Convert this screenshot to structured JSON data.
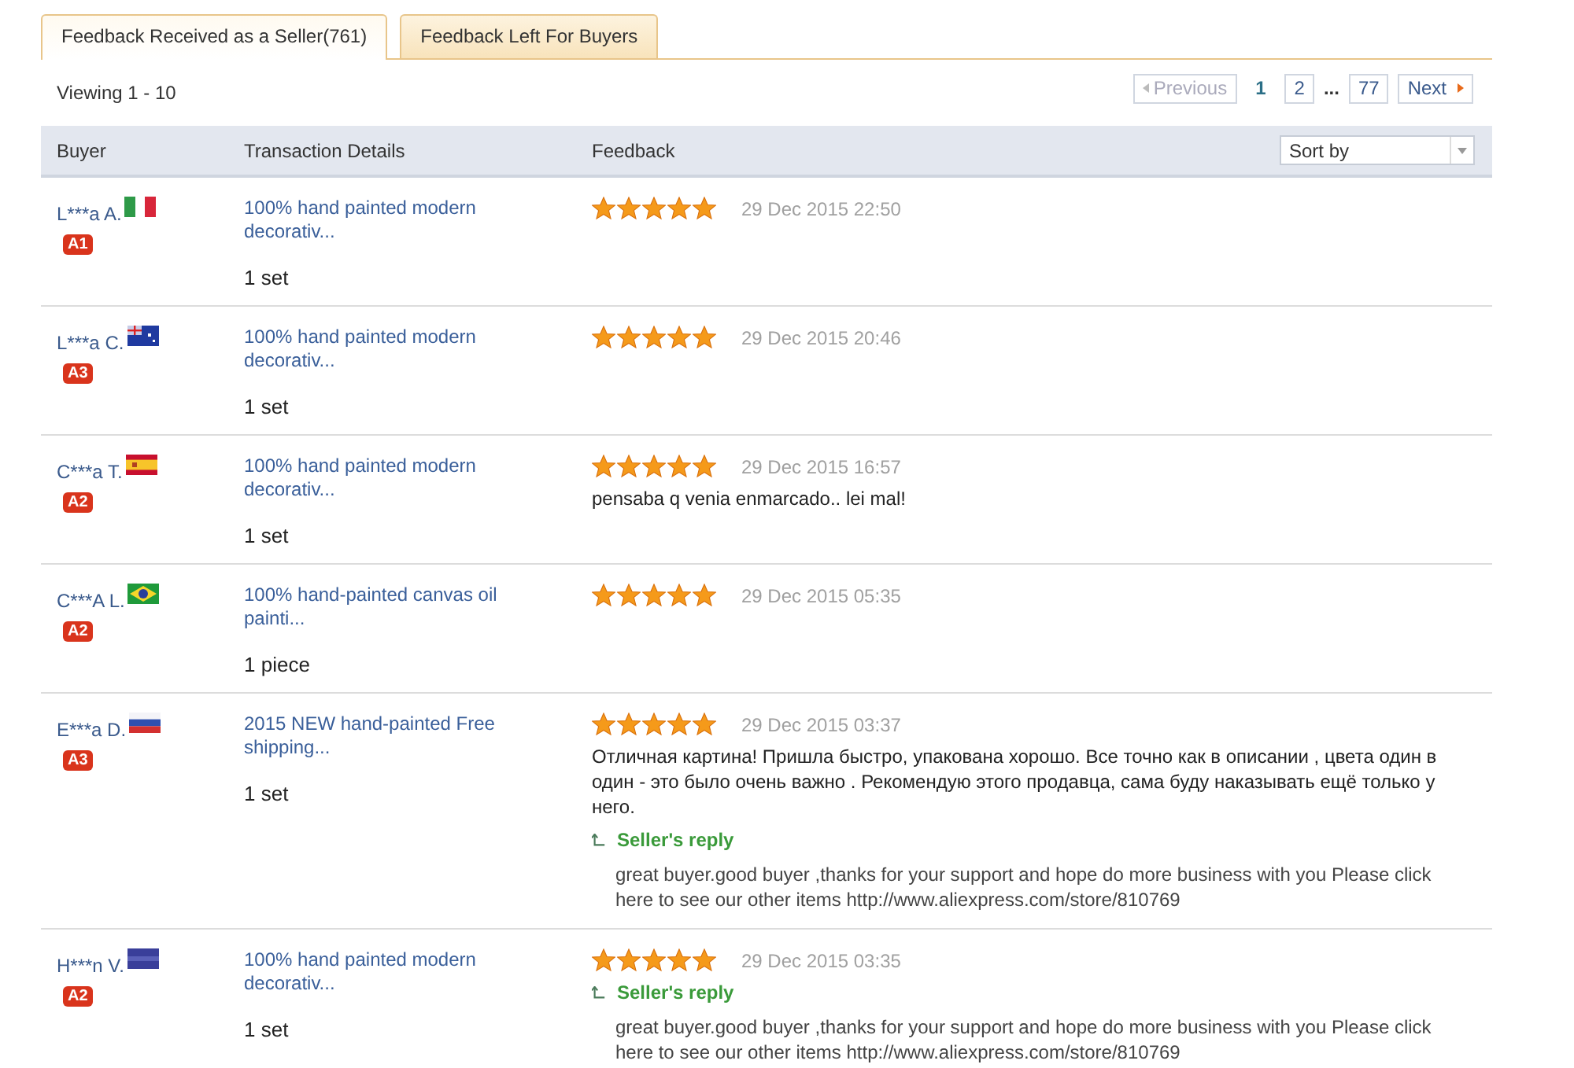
{
  "tabs": [
    {
      "label": "Feedback Received as a Seller(761)",
      "selected": true
    },
    {
      "label": "Feedback Left For Buyers",
      "selected": false
    }
  ],
  "viewing": "Viewing 1 - 10",
  "pagination": [
    {
      "label": "Previous",
      "kind": "prev",
      "disabled": true
    },
    {
      "label": "1",
      "kind": "page",
      "selected": true
    },
    {
      "label": "2",
      "kind": "page",
      "selected": false
    },
    {
      "label": "...",
      "kind": "gap"
    },
    {
      "label": "77",
      "kind": "page",
      "selected": false
    },
    {
      "label": "Next",
      "kind": "next",
      "disabled": false
    }
  ],
  "table": {
    "columns": [
      "Buyer",
      "Transaction Details",
      "Feedback"
    ],
    "sort": {
      "placeholder": "Sort by"
    },
    "rows": [
      {
        "buyer": "L***a A.",
        "kind": "italy",
        "badge": "A1",
        "product": "100% hand painted modern decorativ...",
        "quantity": "1 set",
        "stars": 5,
        "date": "29 Dec 2015 22:50"
      },
      {
        "buyer": "L***a C.",
        "kind": "australia",
        "badge": "A3",
        "product": "100% hand painted modern decorativ...",
        "quantity": "1 set",
        "stars": 5,
        "date": "29 Dec 2015 20:46"
      },
      {
        "buyer": "C***a T.",
        "kind": "spain",
        "badge": "A2",
        "product": "100% hand painted modern decorativ...",
        "quantity": "1 set",
        "stars": 5,
        "date": "29 Dec 2015 16:57",
        "comment": "pensaba q venia enmarcado.. lei mal!"
      },
      {
        "buyer": "C***A L.",
        "kind": "brazil",
        "badge": "A2",
        "product": "100% hand-painted canvas oil painti...",
        "quantity": "1 piece",
        "stars": 5,
        "date": "29 Dec 2015 05:35"
      },
      {
        "buyer": "E***a D.",
        "kind": "russia",
        "badge": "A3",
        "product": "2015 NEW hand-painted Free shipping...",
        "quantity": "1 set",
        "stars": 5,
        "date": "29 Dec 2015 03:37",
        "comment": "Отличная картина! Пришла быстро, упакована хорошо. Все точно как в описании , цвета один в один - это было очень важно . Рекомендую этого продавца, сама буду наказывать ещё только у него.",
        "reply_label": "Seller's reply",
        "reply": "great buyer.good buyer ,thanks for your support and hope do more business with you Please click here to see our other items http://www.aliexpress.com/store/810769"
      },
      {
        "buyer": "H***n V.",
        "kind": "bluestripe",
        "badge": "A2",
        "product": "100% hand painted modern decorativ...",
        "quantity": "1 set",
        "stars": 5,
        "date": "29 Dec 2015 03:35",
        "reply_label": "Seller's reply",
        "reply": "great buyer.good buyer ,thanks for your support and hope do more business with you Please click here to see our other items http://www.aliexpress.com/store/810769"
      }
    ]
  }
}
